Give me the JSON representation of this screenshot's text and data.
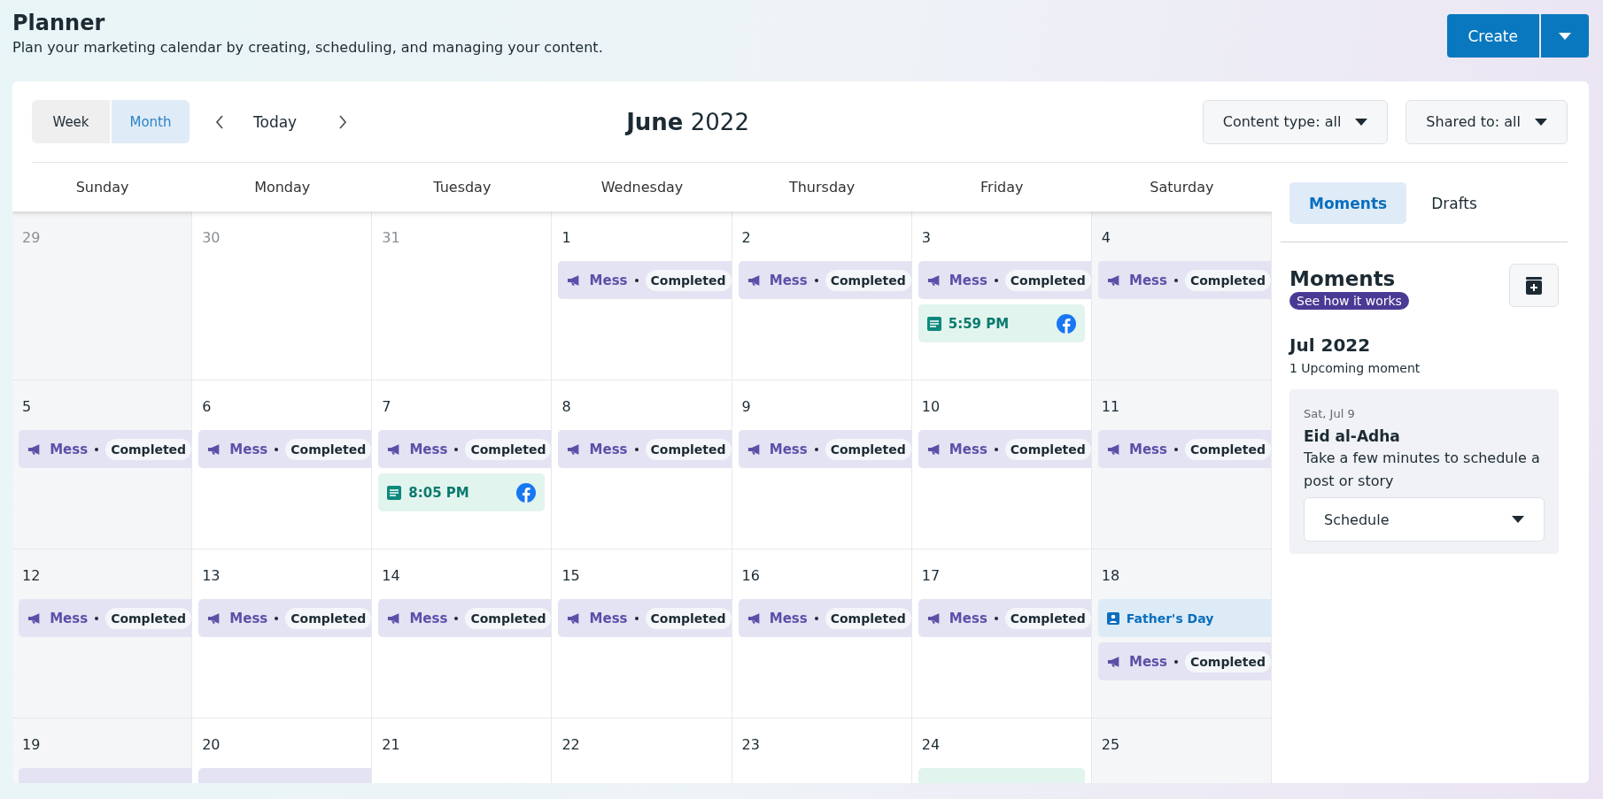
{
  "page": {
    "title": "Planner",
    "subtitle": "Plan your marketing calendar by creating, scheduling, and managing your content.",
    "create_button": "Create"
  },
  "toolbar": {
    "views": [
      {
        "label": "Week",
        "selected": false
      },
      {
        "label": "Month",
        "selected": true
      }
    ],
    "today": "Today",
    "period": "**June** 2022",
    "filters": [
      "Content type: all",
      "Shared to: all"
    ]
  },
  "calendar": {
    "weekdays": [
      "Sunday",
      "Monday",
      "Tuesday",
      "Wednesday",
      "Thursday",
      "Friday",
      "Saturday"
    ],
    "weeks": [
      [
        {
          "date": "29",
          "in_month": false
        },
        {
          "date": "30",
          "in_month": false
        },
        {
          "date": "31",
          "in_month": false
        },
        {
          "date": "1",
          "in_month": true,
          "entries": [
            {
              "kind": "message",
              "label": "Mess",
              "status": "Completed"
            }
          ]
        },
        {
          "date": "2",
          "in_month": true,
          "entries": [
            {
              "kind": "message",
              "label": "Mess",
              "status": "Completed"
            }
          ]
        },
        {
          "date": "3",
          "in_month": true,
          "entries": [
            {
              "kind": "message",
              "label": "Mess",
              "status": "Completed"
            },
            {
              "kind": "post",
              "time": "5:59 PM"
            }
          ]
        },
        {
          "date": "4",
          "in_month": true,
          "entries": [
            {
              "kind": "message",
              "label": "Mess",
              "status": "Completed"
            }
          ]
        }
      ],
      [
        {
          "date": "5",
          "in_month": true,
          "entries": [
            {
              "kind": "message",
              "label": "Mess",
              "status": "Completed"
            }
          ]
        },
        {
          "date": "6",
          "in_month": true,
          "entries": [
            {
              "kind": "message",
              "label": "Mess",
              "status": "Completed"
            }
          ]
        },
        {
          "date": "7",
          "in_month": true,
          "entries": [
            {
              "kind": "message",
              "label": "Mess",
              "status": "Completed"
            },
            {
              "kind": "post",
              "time": "8:05 PM"
            }
          ]
        },
        {
          "date": "8",
          "in_month": true,
          "entries": [
            {
              "kind": "message",
              "label": "Mess",
              "status": "Completed"
            }
          ]
        },
        {
          "date": "9",
          "in_month": true,
          "entries": [
            {
              "kind": "message",
              "label": "Mess",
              "status": "Completed"
            }
          ]
        },
        {
          "date": "10",
          "in_month": true,
          "entries": [
            {
              "kind": "message",
              "label": "Mess",
              "status": "Completed"
            }
          ]
        },
        {
          "date": "11",
          "in_month": true,
          "entries": [
            {
              "kind": "message",
              "label": "Mess",
              "status": "Completed"
            }
          ]
        }
      ],
      [
        {
          "date": "12",
          "in_month": true,
          "entries": [
            {
              "kind": "message",
              "label": "Mess",
              "status": "Completed"
            }
          ]
        },
        {
          "date": "13",
          "in_month": true,
          "entries": [
            {
              "kind": "message",
              "label": "Mess",
              "status": "Completed"
            }
          ]
        },
        {
          "date": "14",
          "in_month": true,
          "entries": [
            {
              "kind": "message",
              "label": "Mess",
              "status": "Completed"
            }
          ]
        },
        {
          "date": "15",
          "in_month": true,
          "entries": [
            {
              "kind": "message",
              "label": "Mess",
              "status": "Completed"
            }
          ]
        },
        {
          "date": "16",
          "in_month": true,
          "entries": [
            {
              "kind": "message",
              "label": "Mess",
              "status": "Completed"
            }
          ]
        },
        {
          "date": "17",
          "in_month": true,
          "entries": [
            {
              "kind": "message",
              "label": "Mess",
              "status": "Completed"
            }
          ]
        },
        {
          "date": "18",
          "in_month": true,
          "entries": [
            {
              "kind": "moment",
              "label": "Father's Day"
            },
            {
              "kind": "message",
              "label": "Mess",
              "status": "Completed"
            }
          ]
        }
      ],
      [
        {
          "date": "19",
          "in_month": true,
          "entries": [
            {
              "kind": "message"
            }
          ]
        },
        {
          "date": "20",
          "in_month": true,
          "entries": [
            {
              "kind": "message"
            }
          ]
        },
        {
          "date": "21",
          "in_month": true
        },
        {
          "date": "22",
          "in_month": true
        },
        {
          "date": "23",
          "in_month": true
        },
        {
          "date": "24",
          "in_month": true,
          "entries": [
            {
              "kind": "post"
            }
          ]
        },
        {
          "date": "25",
          "in_month": true
        }
      ]
    ]
  },
  "sidebar": {
    "tabs": [
      {
        "label": "Moments",
        "selected": true
      },
      {
        "label": "Drafts",
        "selected": false
      }
    ],
    "heading": "Moments",
    "help_badge": "See how it works",
    "month": "Jul 2022",
    "count": "1 Upcoming moment",
    "moments": [
      {
        "date": "Sat, Jul 9",
        "title": "Eid al-Adha",
        "description": "Take a few minutes to schedule a post or story",
        "action": "Schedule"
      }
    ]
  }
}
